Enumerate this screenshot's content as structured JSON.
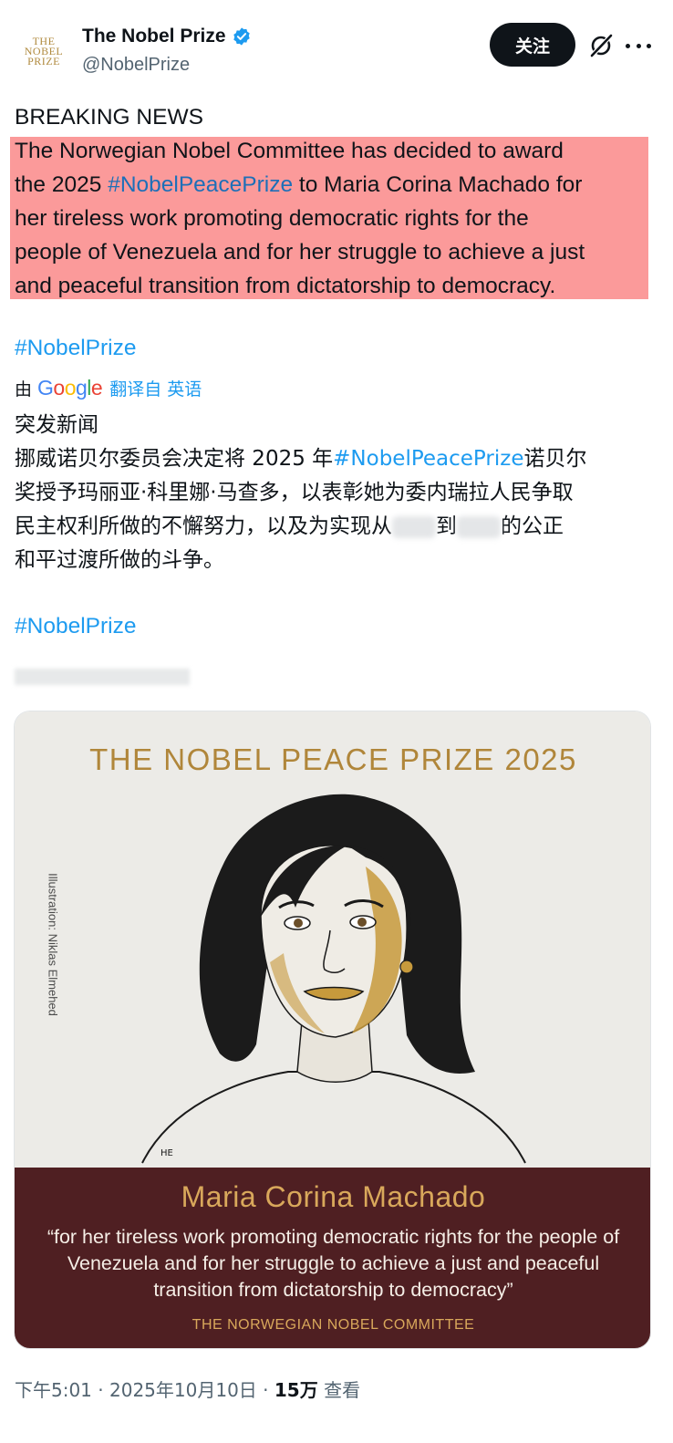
{
  "author": {
    "display_name": "The Nobel Prize",
    "handle": "@NobelPrize",
    "avatar_lines": [
      "THE",
      "NOBEL",
      "PRIZE"
    ],
    "verified": true
  },
  "actions": {
    "follow_label": "关注",
    "grok_icon": "grok-icon",
    "more_icon": "more-icon"
  },
  "tweet": {
    "heading": "BREAKING NEWS",
    "en_lines": [
      {
        "pre": "The Norwegian Nobel Committee has decided to award",
        "tag": "",
        "post": ""
      },
      {
        "pre": "the 2025 ",
        "tag": "#NobelPeacePrize",
        "post": " to Maria Corina Machado for"
      },
      {
        "pre": "her tireless work promoting democratic rights for the",
        "tag": "",
        "post": ""
      },
      {
        "pre": "people of Venezuela and for her struggle to achieve a just",
        "tag": "",
        "post": ""
      },
      {
        "pre": "and peaceful transition from dictatorship to democracy.",
        "tag": "",
        "post": ""
      }
    ],
    "hashtag_en": "#NobelPrize",
    "highlight_color": "#fb9a9a"
  },
  "translation": {
    "by": "由",
    "provider": "Google",
    "link_label": "翻译自 英语",
    "heading": "突发新闻",
    "lines": [
      {
        "pre": "挪威诺贝尔委员会决定将 2025 年",
        "tag": "#NobelPeacePrize",
        "post": "诺贝尔"
      },
      {
        "pre": "奖授予玛丽亚·科里娜·马查多，以表彰她为委内瑞拉人民争取",
        "tag": "",
        "post": ""
      },
      {
        "pre": "民主权利所做的不懈努力，以及为实现从",
        "tag": "",
        "post": "到",
        "post2": "的公正"
      },
      {
        "pre": "和平过渡所做的斗争。",
        "tag": "",
        "post": ""
      }
    ],
    "hashtag": "#NobelPrize"
  },
  "media": {
    "title": "THE NOBEL PEACE PRIZE 2025",
    "credit": "Illustration: Niklas Elmehed",
    "laureate": "Maria Corina Machado",
    "citation": "“for her tireless work promoting democratic rights for the people of Venezuela and for her struggle to achieve a just and peaceful transition from dictatorship to democracy”",
    "committee": "THE NORWEGIAN NOBEL COMMITTEE",
    "top_bg": "#ecebe7",
    "bottom_bg": "#4f1f22",
    "gold": "#b0863a"
  },
  "meta": {
    "time": "下午5:01",
    "date": "2025年10月10日",
    "views": "15万",
    "views_label": "查看"
  },
  "colors": {
    "link": "#1d9bf0",
    "text": "#0f1419",
    "muted": "#536471"
  }
}
